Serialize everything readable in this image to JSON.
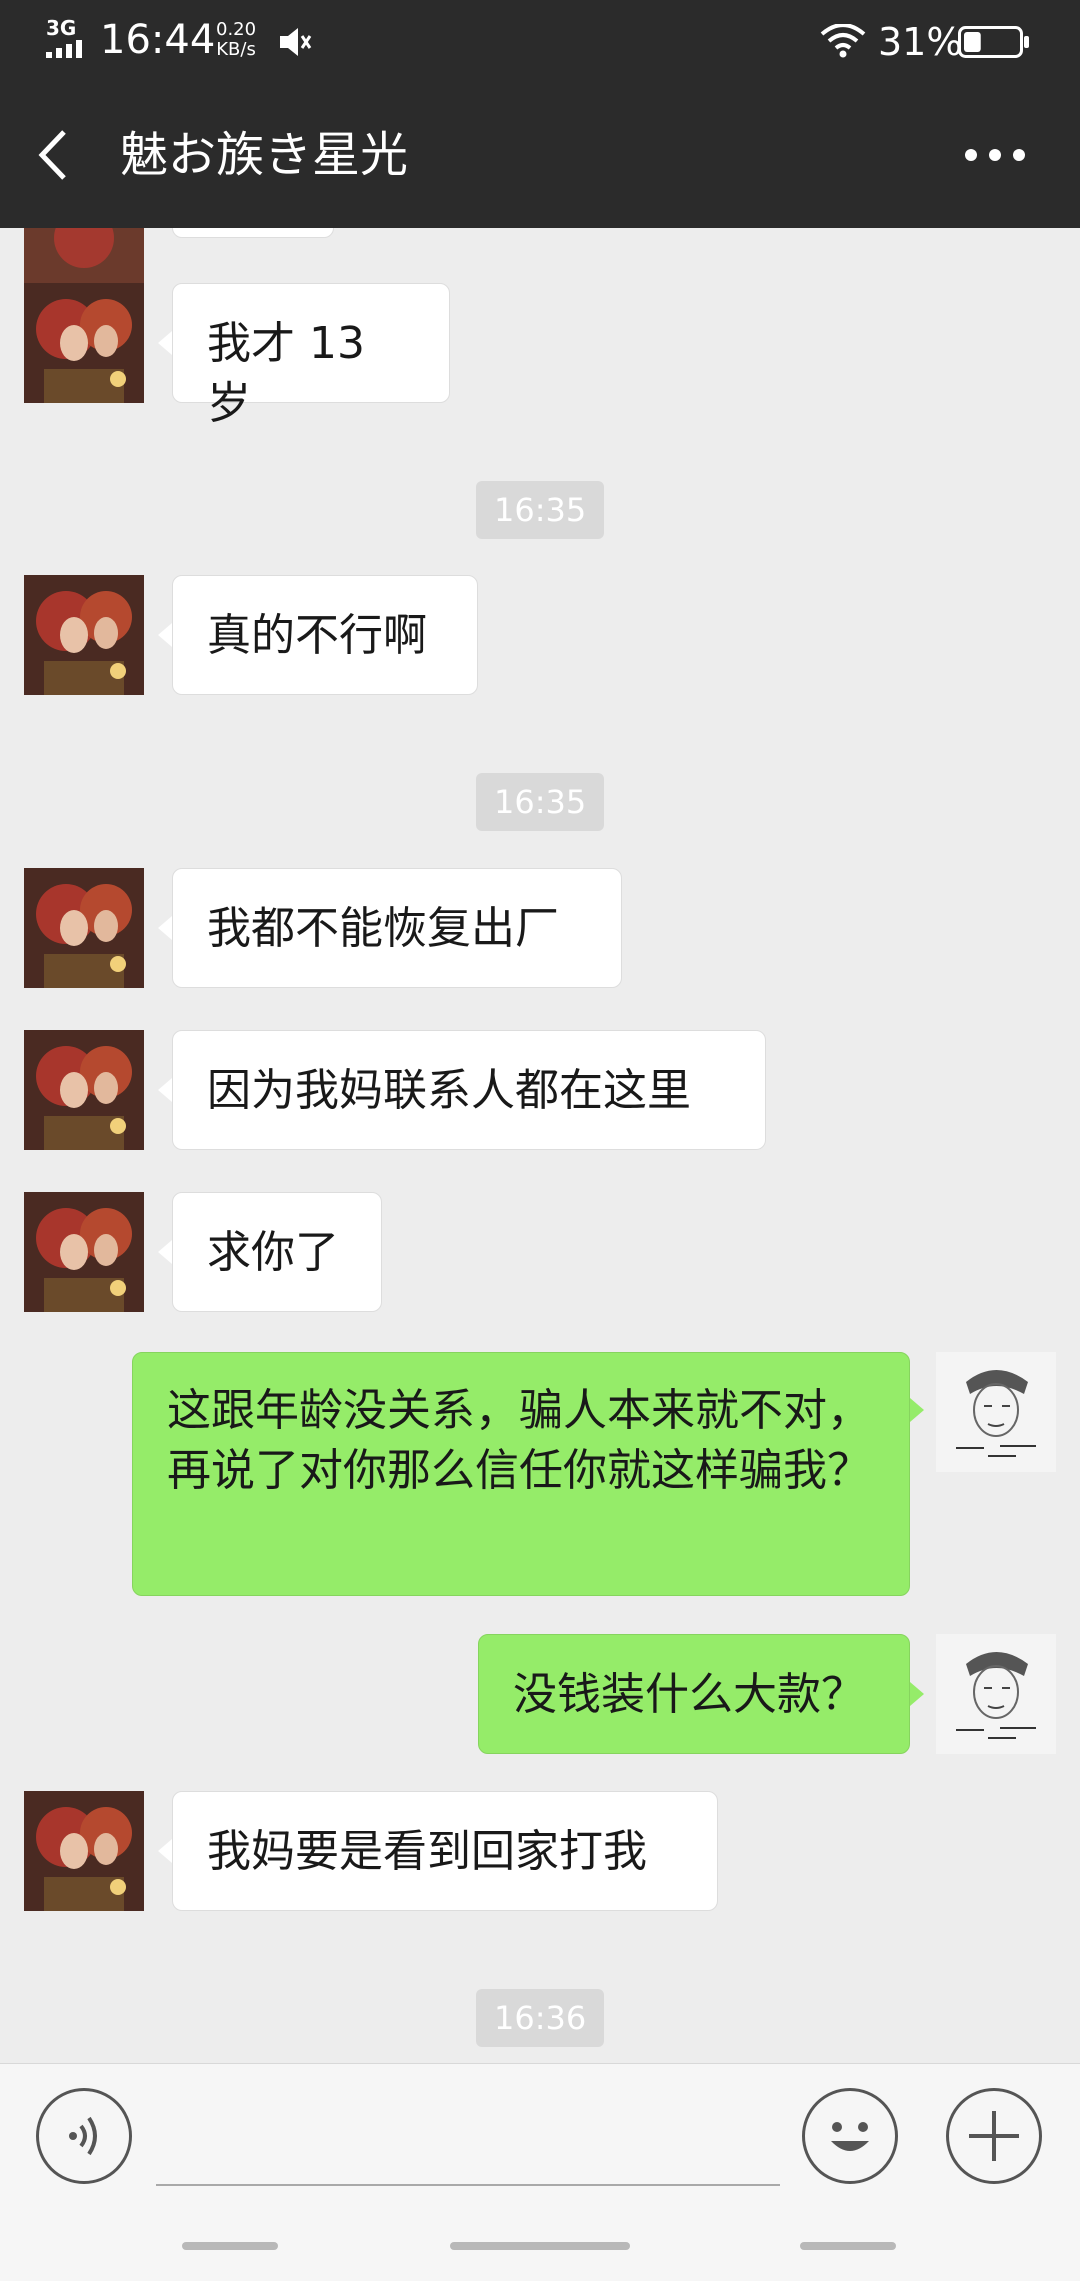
{
  "status_bar": {
    "network": "3G",
    "time": "16:44",
    "speed_value": "0.20",
    "speed_unit": "KB/s",
    "battery_percent": "31%",
    "battery_level": 0.31
  },
  "header": {
    "title": "魅お族き星光",
    "back_icon": "chevron-left-icon",
    "more_icon": "more-dots-icon"
  },
  "messages": [
    {
      "side": "in",
      "text": "我才 13 岁"
    },
    {
      "time": "16:35"
    },
    {
      "side": "in",
      "text": "真的不行啊"
    },
    {
      "time": "16:35"
    },
    {
      "side": "in",
      "text": "我都不能恢复出厂"
    },
    {
      "side": "in",
      "text": "因为我妈联系人都在这里"
    },
    {
      "side": "in",
      "text": "求你了"
    },
    {
      "side": "out",
      "text": "这跟年龄没关系，骗人本来就不对，再说了对你那么信任你就这样骗我？"
    },
    {
      "side": "out",
      "text": "没钱装什么大款？"
    },
    {
      "side": "in",
      "text": "我妈要是看到回家打我"
    },
    {
      "time": "16:36"
    }
  ],
  "input_bar": {
    "voice_icon": "voice-icon",
    "emoji_icon": "emoji-icon",
    "plus_icon": "plus-icon"
  },
  "colors": {
    "header_bg": "#2b2b2b",
    "chat_bg": "#ededed",
    "outgoing_bubble": "#95ec69",
    "incoming_bubble": "#ffffff"
  }
}
